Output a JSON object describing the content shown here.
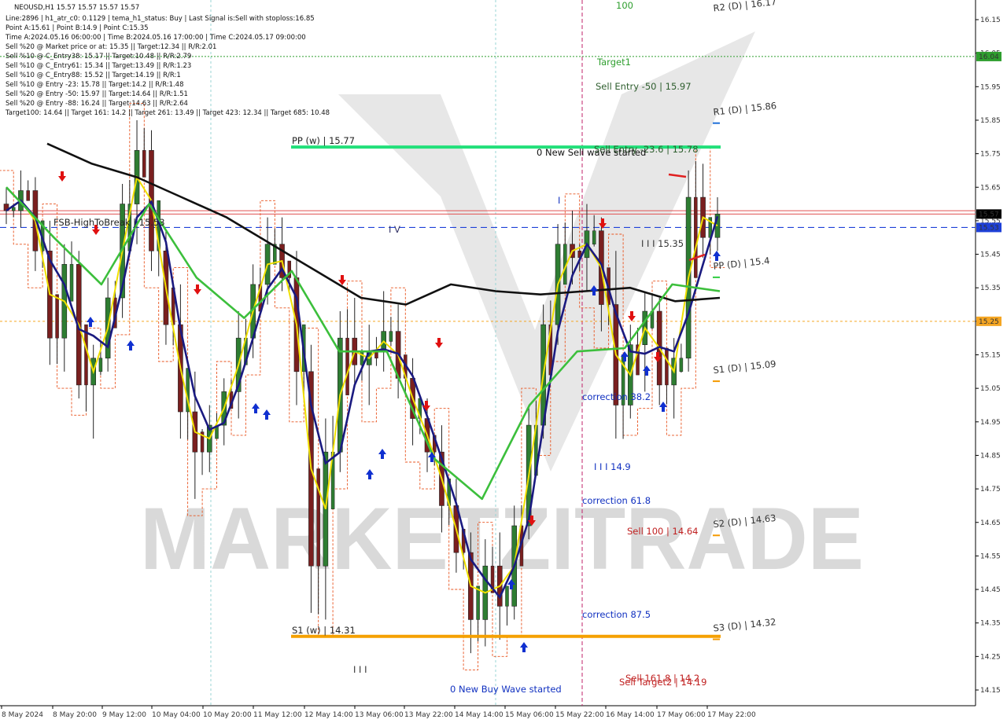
{
  "chart_data": {
    "type": "candlestick",
    "symbol": "NEOUSD,H1",
    "header": "NEOUSD,H1  15.57 15.57 15.57 15.57",
    "info_lines": [
      "Line:2896 | h1_atr_c0: 0.1129 | tema_h1_status: Buy | Last Signal is:Sell with stoploss:16.85",
      "Point A:15.61 | Point B:14.9 | Point C:15.35",
      "Time A:2024.05.16 06:00:00 | Time B:2024.05.16 17:00:00 | Time C:2024.05.17 09:00:00",
      "Sell %20 @ Market price or at: 15.35 || Target:12.34 || R/R:2.01",
      "Sell %10 @ C_Entry38: 15.17 || Target:10.48 || R/R:2.79",
      "Sell %10 @ C_Entry61: 15.34 || Target:13.49 || R/R:1.23",
      "Sell %10 @ C_Entry88: 15.52 || Target:14.19 || R/R:1",
      "Sell %10 @ Entry -23: 15.78 || Target:14.2 || R/R:1.48",
      "Sell %20 @ Entry -50: 15.97 || Target:14.64 || R/R:1.51",
      "Sell %20 @ Entry -88: 16.24 || Target:14.63 || R/R:2.64",
      "Target100: 14.64 || Target 161: 14.2 || Target 261: 13.49 || Target 423: 12.34 || Target 685: 10.48"
    ],
    "y_ticks": [
      "16.15",
      "16.05",
      "15.95",
      "15.85",
      "15.75",
      "15.65",
      "15.55",
      "15.45",
      "15.35",
      "15.25",
      "15.15",
      "15.05",
      "14.95",
      "14.85",
      "14.75",
      "14.65",
      "14.55",
      "14.45",
      "14.35",
      "14.25",
      "14.15"
    ],
    "ylim": [
      14.12,
      16.2
    ],
    "x_ticks": [
      "8 May 2024",
      "8 May 20:00",
      "9 May 12:00",
      "10 May 04:00",
      "10 May 20:00",
      "11 May 12:00",
      "12 May 14:00",
      "13 May 06:00",
      "13 May 22:00",
      "14 May 14:00",
      "15 May 06:00",
      "15 May 22:00",
      "16 May 14:00",
      "17 May 06:00",
      "17 May 22:00"
    ],
    "price_tags": [
      {
        "text": "16.04",
        "value": 16.04,
        "color": "#2e9e2e"
      },
      {
        "text": "15.57",
        "value": 15.57,
        "color": "#000000"
      },
      {
        "text": "15.53",
        "value": 15.53,
        "color": "#1e40d8"
      },
      {
        "text": "15.25",
        "value": 15.25,
        "color": "#f5a623"
      }
    ],
    "levels": [
      {
        "label": "PP (w) | 15.77",
        "value": 15.77,
        "color": "#22e07a"
      },
      {
        "label": "S1 (w) | 14.31",
        "value": 14.31,
        "color": "#f5a000"
      },
      {
        "label": "R2 (D) | 16.17",
        "value": 16.17
      },
      {
        "label": "R1 (D) | 15.86",
        "value": 15.86
      },
      {
        "label": "PP (D) | 15.4",
        "value": 15.4
      },
      {
        "label": "S1 (D) | 15.09",
        "value": 15.09
      },
      {
        "label": "S2 (D) | 14.63",
        "value": 14.63
      },
      {
        "label": "S3 (D) | 14.32",
        "value": 14.32
      }
    ],
    "annotations": [
      "100",
      "Target1",
      "Sell Entry -50 | 15.97",
      "Sell Entry -23.6 | 15.78",
      "0 New Sell wave started",
      "FSB-HighToBreak | 15.53",
      "I V",
      "I I I 15.35",
      "correction 38.2",
      "I I I 14.9",
      "correction 61.8",
      "Sell 100 | 14.64",
      "correction 87.5",
      "Sell 161.8 | 14.2",
      "Sell Target2 | 14.19",
      "0 New Buy Wave started",
      "I I I",
      "I",
      "Target2",
      "Target1"
    ],
    "watermark": "MARKETZITRADE",
    "series": [
      {
        "name": "ma_black",
        "values": [
          15.78,
          15.72,
          15.68,
          15.62,
          15.56,
          15.48,
          15.4,
          15.32,
          15.3,
          15.36,
          15.34,
          15.33,
          15.34,
          15.35,
          15.31,
          15.32
        ]
      },
      {
        "name": "ma_green",
        "values": [
          15.65,
          15.5,
          15.36,
          15.6,
          15.38,
          15.26,
          15.4,
          15.16,
          15.16,
          14.84,
          14.72,
          15.0,
          15.16,
          15.17,
          15.36,
          15.34
        ]
      }
    ],
    "candles_ohlc": [
      [
        15.6,
        15.65,
        15.54,
        15.58
      ],
      [
        15.58,
        15.7,
        15.53,
        15.64
      ],
      [
        15.64,
        15.68,
        15.4,
        15.46
      ],
      [
        15.46,
        15.55,
        15.12,
        15.2
      ],
      [
        15.2,
        15.48,
        15.1,
        15.42
      ],
      [
        15.42,
        15.46,
        15.02,
        15.06
      ],
      [
        15.06,
        15.18,
        14.9,
        15.14
      ],
      [
        15.14,
        15.38,
        15.1,
        15.32
      ],
      [
        15.32,
        15.66,
        15.26,
        15.6
      ],
      [
        15.6,
        15.85,
        15.48,
        15.76
      ],
      [
        15.76,
        15.82,
        15.4,
        15.46
      ],
      [
        15.46,
        15.52,
        15.18,
        15.24
      ],
      [
        15.24,
        15.36,
        14.9,
        14.98
      ],
      [
        14.98,
        15.1,
        14.72,
        14.86
      ],
      [
        14.86,
        15.0,
        14.8,
        14.94
      ],
      [
        14.94,
        15.08,
        14.88,
        15.04
      ],
      [
        15.04,
        15.28,
        14.96,
        15.2
      ],
      [
        15.2,
        15.42,
        15.14,
        15.36
      ],
      [
        15.36,
        15.56,
        15.3,
        15.48
      ],
      [
        15.48,
        15.56,
        15.34,
        15.38
      ],
      [
        15.38,
        15.46,
        15.0,
        15.1
      ],
      [
        15.1,
        15.18,
        14.38,
        14.52
      ],
      [
        14.52,
        14.96,
        14.36,
        14.86
      ],
      [
        14.86,
        15.28,
        14.8,
        15.2
      ],
      [
        15.2,
        15.32,
        15.06,
        15.12
      ],
      [
        15.12,
        15.24,
        15.0,
        15.16
      ],
      [
        15.16,
        15.34,
        15.1,
        15.22
      ],
      [
        15.22,
        15.3,
        15.02,
        15.08
      ],
      [
        15.08,
        15.14,
        14.88,
        14.96
      ],
      [
        14.96,
        15.02,
        14.8,
        14.86
      ],
      [
        14.86,
        14.94,
        14.62,
        14.7
      ],
      [
        14.7,
        14.78,
        14.5,
        14.56
      ],
      [
        14.56,
        14.62,
        14.26,
        14.36
      ],
      [
        14.36,
        14.6,
        14.28,
        14.52
      ],
      [
        14.52,
        14.62,
        14.3,
        14.4
      ],
      [
        14.4,
        14.7,
        14.36,
        14.64
      ],
      [
        14.64,
        15.0,
        14.6,
        14.94
      ],
      [
        14.94,
        15.3,
        14.9,
        15.24
      ],
      [
        15.24,
        15.54,
        15.18,
        15.48
      ],
      [
        15.48,
        15.58,
        15.36,
        15.44
      ],
      [
        15.44,
        15.6,
        15.34,
        15.52
      ],
      [
        15.52,
        15.56,
        15.22,
        15.3
      ],
      [
        15.3,
        15.46,
        14.9,
        15.0
      ],
      [
        15.0,
        15.24,
        14.96,
        15.18
      ],
      [
        15.18,
        15.34,
        15.04,
        15.28
      ],
      [
        15.28,
        15.32,
        15.0,
        15.06
      ],
      [
        15.06,
        15.2,
        14.96,
        15.14
      ],
      [
        15.14,
        15.7,
        15.1,
        15.62
      ],
      [
        15.62,
        15.72,
        15.44,
        15.5
      ],
      [
        15.5,
        15.62,
        15.46,
        15.57
      ]
    ]
  }
}
